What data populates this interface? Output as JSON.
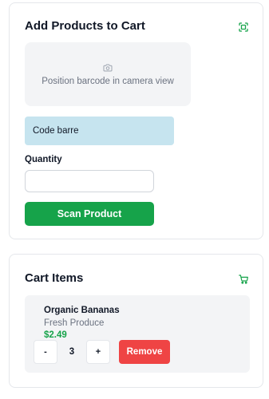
{
  "scanner": {
    "title": "Add Products to Cart",
    "header_icon": "scan-icon",
    "camera": {
      "icon": "camera-icon",
      "hint": "Position barcode in camera view"
    },
    "code_field_text": "Code barre",
    "quantity_label": "Quantity",
    "quantity_value": "",
    "quantity_placeholder": "",
    "scan_button_label": "Scan Product"
  },
  "cart": {
    "title": "Cart Items",
    "header_icon": "cart-icon",
    "items": [
      {
        "name": "Organic Bananas",
        "category": "Fresh Produce",
        "price": "$2.49",
        "decrement_label": "-",
        "quantity": "3",
        "increment_label": "+",
        "remove_label": "Remove"
      }
    ]
  },
  "colors": {
    "accent_green": "#16a34a",
    "danger_red": "#ef4444",
    "code_field_bg": "#c6e4ef",
    "panel_gray": "#f3f4f6"
  }
}
